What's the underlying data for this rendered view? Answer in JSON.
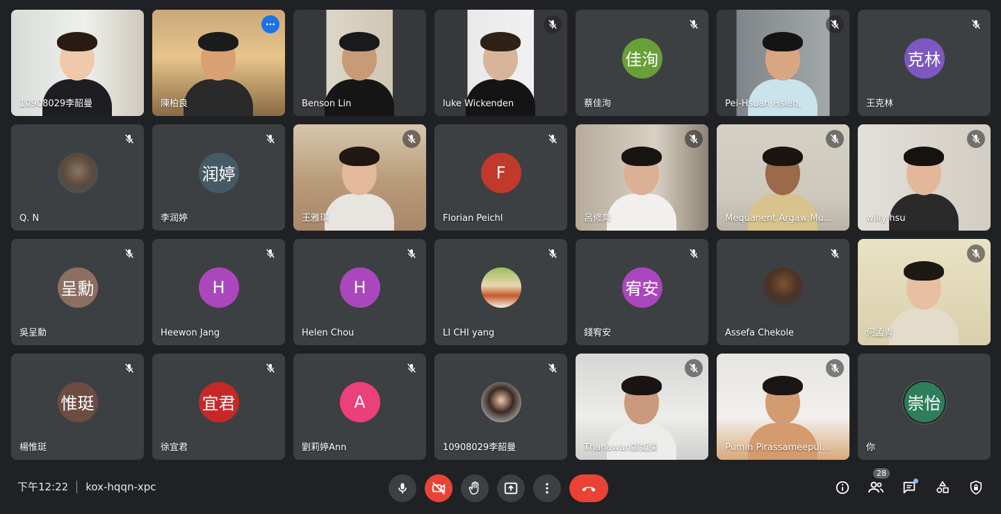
{
  "participants": [
    {
      "name": "10908029李韶曼",
      "type": "video",
      "scene": "office-woman",
      "muted": false
    },
    {
      "name": "陳柏良",
      "type": "video",
      "scene": "man-glasses",
      "muted": false,
      "active": true
    },
    {
      "name": "Benson Lin",
      "type": "video",
      "scene": "man-dark",
      "muted": false
    },
    {
      "name": "luke Wickenden",
      "type": "video",
      "scene": "young-man",
      "muted": true
    },
    {
      "name": "蔡佳洵",
      "type": "avatar",
      "initials": "佳洵",
      "color": "#689f38",
      "muted": true
    },
    {
      "name": "Pei-Hsuan Hsieh,",
      "type": "video",
      "scene": "car-woman",
      "muted": true
    },
    {
      "name": "王克林",
      "type": "avatar",
      "initials": "克林",
      "color": "#7e57c2",
      "muted": true
    },
    {
      "name": "Q. N",
      "type": "photo",
      "avatar": "raccoon-photo",
      "muted": true
    },
    {
      "name": "李润婷",
      "type": "avatar",
      "initials": "润婷",
      "color": "#455a64",
      "muted": true
    },
    {
      "name": "王雅琪",
      "type": "video",
      "scene": "girl-room",
      "muted": true
    },
    {
      "name": "Florian Peichl",
      "type": "avatar",
      "initials": "F",
      "color": "#c0392b",
      "muted": true
    },
    {
      "name": "呂修齊",
      "type": "video",
      "scene": "boy-white",
      "muted": true
    },
    {
      "name": "Mequanent Argaw Mu...",
      "type": "video",
      "scene": "man-room",
      "muted": true
    },
    {
      "name": "willy hsu",
      "type": "video",
      "scene": "boy-close",
      "muted": true
    },
    {
      "name": "吳呈勳",
      "type": "avatar",
      "initials": "呈勳",
      "color": "#8d6e63",
      "muted": true
    },
    {
      "name": "Heewon Jang",
      "type": "avatar",
      "initials": "H",
      "color": "#ab47bc",
      "muted": true
    },
    {
      "name": "Helen Chou",
      "type": "avatar",
      "initials": "H",
      "color": "#ab47bc",
      "muted": true
    },
    {
      "name": "LI CHI yang",
      "type": "photo",
      "avatar": "flower-cart-photo",
      "muted": true
    },
    {
      "name": "錢宥安",
      "type": "avatar",
      "initials": "宥安",
      "color": "#ab47bc",
      "muted": true
    },
    {
      "name": "Assefa Chekole",
      "type": "photo",
      "avatar": "man-portrait-photo",
      "muted": true
    },
    {
      "name": "何孟青",
      "type": "video",
      "scene": "woman-glasses",
      "muted": true
    },
    {
      "name": "楊惟珽",
      "type": "avatar",
      "initials": "惟珽",
      "color": "#6d4c41",
      "muted": true
    },
    {
      "name": "徐宜君",
      "type": "avatar",
      "initials": "宜君",
      "color": "#c62828",
      "muted": true
    },
    {
      "name": "劉莉婷Ann",
      "type": "avatar",
      "initials": "A",
      "color": "#ec407a",
      "muted": true
    },
    {
      "name": "10908029李韶曼",
      "type": "photo",
      "avatar": "woman-portrait-photo",
      "muted": true
    },
    {
      "name": "Thanawan鄭如榮",
      "type": "video",
      "scene": "girl-white",
      "muted": true
    },
    {
      "name": "Pumin Pirassameepul...",
      "type": "video",
      "scene": "boy-bottom",
      "muted": true
    },
    {
      "name": "你",
      "type": "avatar",
      "initials": "崇怡",
      "color": "#2e7d5b",
      "muted": false,
      "ring": true
    }
  ],
  "meeting": {
    "time": "下午12:22",
    "code": "kox-hqqn-xpc"
  },
  "controls": [
    "mic-icon",
    "camera-off-icon",
    "raise-hand-icon",
    "present-icon",
    "more-icon",
    "hangup-icon"
  ],
  "right_controls": {
    "people_count": "28"
  }
}
